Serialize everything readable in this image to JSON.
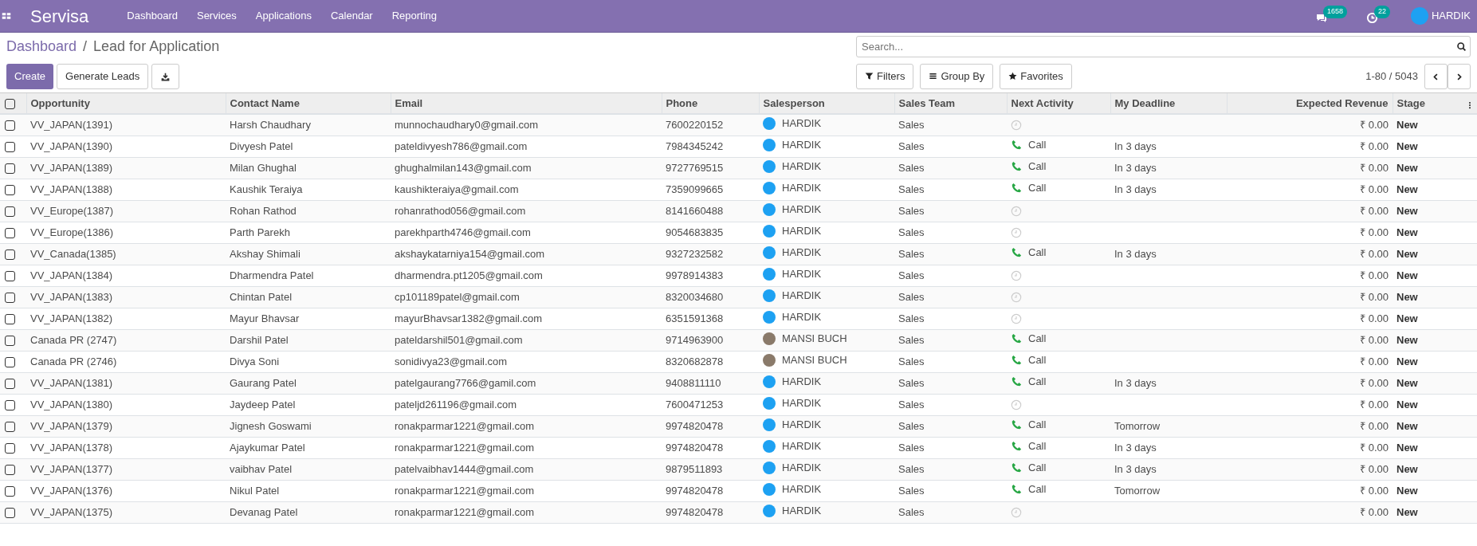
{
  "navbar": {
    "app_title": "Servisa",
    "menu": [
      "Dashboard",
      "Services",
      "Applications",
      "Calendar",
      "Reporting"
    ],
    "messages_count": "1658",
    "activities_count": "22",
    "user": "HARDIK"
  },
  "breadcrumb": {
    "parent": "Dashboard",
    "separator": "/",
    "current": "Lead for Application"
  },
  "buttons": {
    "create": "Create",
    "generate": "Generate Leads"
  },
  "search": {
    "placeholder": "Search..."
  },
  "filters": [
    "Filters",
    "Group By",
    "Favorites"
  ],
  "pager": "1-80 / 5043",
  "table": {
    "select_all_checked": false,
    "columns": [
      "Opportunity",
      "Contact Name",
      "Email",
      "Phone",
      "Salesperson",
      "Sales Team",
      "Next Activity",
      "My Deadline",
      "Expected Revenue",
      "Stage"
    ],
    "rows": [
      {
        "checked": false,
        "opportunity": "VV_JAPAN(1391)",
        "contact": "Harsh Chaudhary",
        "email": "munnochaudhary0@gmail.com",
        "phone": "7600220152",
        "salesperson": {
          "name": "HARDIK",
          "kind": "logo"
        },
        "team": "Sales",
        "activity": {
          "kind": "none"
        },
        "revenue": "₹ 0.00",
        "stage": "New"
      },
      {
        "checked": false,
        "opportunity": "VV_JAPAN(1390)",
        "contact": "Divyesh Patel",
        "email": "pateldivyesh786@gmail.com",
        "phone": "7984345242",
        "salesperson": {
          "name": "HARDIK",
          "kind": "logo"
        },
        "team": "Sales",
        "activity": {
          "kind": "call",
          "label": "Call"
        },
        "deadline": "In 3 days",
        "revenue": "₹ 0.00",
        "stage": "New"
      },
      {
        "checked": false,
        "opportunity": "VV_JAPAN(1389)",
        "contact": "Milan Ghughal",
        "email": "ghughalmilan143@gmail.com",
        "phone": "9727769515",
        "salesperson": {
          "name": "HARDIK",
          "kind": "logo"
        },
        "team": "Sales",
        "activity": {
          "kind": "call",
          "label": "Call"
        },
        "deadline": "In 3 days",
        "revenue": "₹ 0.00",
        "stage": "New"
      },
      {
        "checked": false,
        "opportunity": "VV_JAPAN(1388)",
        "contact": "Kaushik Teraiya",
        "email": "kaushikteraiya@gmail.com",
        "phone": "7359099665",
        "salesperson": {
          "name": "HARDIK",
          "kind": "logo"
        },
        "team": "Sales",
        "activity": {
          "kind": "call",
          "label": "Call"
        },
        "deadline": "In 3 days",
        "revenue": "₹ 0.00",
        "stage": "New"
      },
      {
        "checked": false,
        "opportunity": "VV_Europe(1387)",
        "contact": "Rohan Rathod",
        "email": "rohanrathod056@gmail.com",
        "phone": "8141660488",
        "salesperson": {
          "name": "HARDIK",
          "kind": "logo"
        },
        "team": "Sales",
        "activity": {
          "kind": "none"
        },
        "revenue": "₹ 0.00",
        "stage": "New"
      },
      {
        "checked": false,
        "opportunity": "VV_Europe(1386)",
        "contact": "Parth Parekh",
        "email": "parekhparth4746@gmail.com",
        "phone": "9054683835",
        "salesperson": {
          "name": "HARDIK",
          "kind": "logo"
        },
        "team": "Sales",
        "activity": {
          "kind": "none"
        },
        "revenue": "₹ 0.00",
        "stage": "New"
      },
      {
        "checked": false,
        "opportunity": "VV_Canada(1385)",
        "contact": "Akshay Shimali",
        "email": "akshaykatarniya154@gmail.com",
        "phone": "9327232582",
        "salesperson": {
          "name": "HARDIK",
          "kind": "logo"
        },
        "team": "Sales",
        "activity": {
          "kind": "call",
          "label": "Call"
        },
        "deadline": "In 3 days",
        "revenue": "₹ 0.00",
        "stage": "New"
      },
      {
        "checked": false,
        "opportunity": "VV_JAPAN(1384)",
        "contact": "Dharmendra Patel",
        "email": "dharmendra.pt1205@gmail.com",
        "phone": "9978914383",
        "salesperson": {
          "name": "HARDIK",
          "kind": "logo"
        },
        "team": "Sales",
        "activity": {
          "kind": "none"
        },
        "revenue": "₹ 0.00",
        "stage": "New"
      },
      {
        "checked": false,
        "opportunity": "VV_JAPAN(1383)",
        "contact": "Chintan Patel",
        "email": "cp101189patel@gmail.com",
        "phone": "8320034680",
        "salesperson": {
          "name": "HARDIK",
          "kind": "logo"
        },
        "team": "Sales",
        "activity": {
          "kind": "none"
        },
        "revenue": "₹ 0.00",
        "stage": "New"
      },
      {
        "checked": false,
        "opportunity": "VV_JAPAN(1382)",
        "contact": "Mayur Bhavsar",
        "email": "mayurBhavsar1382@gmail.com",
        "phone": "6351591368",
        "salesperson": {
          "name": "HARDIK",
          "kind": "logo"
        },
        "team": "Sales",
        "activity": {
          "kind": "none"
        },
        "revenue": "₹ 0.00",
        "stage": "New"
      },
      {
        "checked": false,
        "opportunity": "Canada PR (2747)",
        "contact": "Darshil Patel",
        "email": "pateldarshil501@gmail.com",
        "phone": "9714963900",
        "salesperson": {
          "name": "MANSI BUCH",
          "kind": "photo"
        },
        "team": "Sales",
        "activity": {
          "kind": "call",
          "label": "Call"
        },
        "revenue": "₹ 0.00",
        "stage": "New"
      },
      {
        "checked": false,
        "opportunity": "Canada PR (2746)",
        "contact": "Divya Soni",
        "email": "sonidivya23@gmail.com",
        "phone": "8320682878",
        "salesperson": {
          "name": "MANSI BUCH",
          "kind": "photo"
        },
        "team": "Sales",
        "activity": {
          "kind": "call",
          "label": "Call"
        },
        "revenue": "₹ 0.00",
        "stage": "New"
      },
      {
        "checked": false,
        "opportunity": "VV_JAPAN(1381)",
        "contact": "Gaurang Patel",
        "email": "patelgaurang7766@gamil.com",
        "phone": "9408811110",
        "salesperson": {
          "name": "HARDIK",
          "kind": "logo"
        },
        "team": "Sales",
        "activity": {
          "kind": "call",
          "label": "Call"
        },
        "deadline": "In 3 days",
        "revenue": "₹ 0.00",
        "stage": "New"
      },
      {
        "checked": false,
        "opportunity": "VV_JAPAN(1380)",
        "contact": "Jaydeep Patel",
        "email": "pateljd261196@gmail.com",
        "phone": "7600471253",
        "salesperson": {
          "name": "HARDIK",
          "kind": "logo"
        },
        "team": "Sales",
        "activity": {
          "kind": "none"
        },
        "revenue": "₹ 0.00",
        "stage": "New"
      },
      {
        "checked": false,
        "opportunity": "VV_JAPAN(1379)",
        "contact": "Jignesh Goswami",
        "email": "ronakparmar1221@gmail.com",
        "phone": "9974820478",
        "salesperson": {
          "name": "HARDIK",
          "kind": "logo"
        },
        "team": "Sales",
        "activity": {
          "kind": "call",
          "label": "Call"
        },
        "deadline": "Tomorrow",
        "revenue": "₹ 0.00",
        "stage": "New"
      },
      {
        "checked": false,
        "opportunity": "VV_JAPAN(1378)",
        "contact": "Ajaykumar Patel",
        "email": "ronakparmar1221@gmail.com",
        "phone": "9974820478",
        "salesperson": {
          "name": "HARDIK",
          "kind": "logo"
        },
        "team": "Sales",
        "activity": {
          "kind": "call",
          "label": "Call"
        },
        "deadline": "In 3 days",
        "revenue": "₹ 0.00",
        "stage": "New"
      },
      {
        "checked": false,
        "opportunity": "VV_JAPAN(1377)",
        "contact": "vaibhav Patel",
        "email": "patelvaibhav1444@gmail.com",
        "phone": "9879511893",
        "salesperson": {
          "name": "HARDIK",
          "kind": "logo"
        },
        "team": "Sales",
        "activity": {
          "kind": "call",
          "label": "Call"
        },
        "deadline": "In 3 days",
        "revenue": "₹ 0.00",
        "stage": "New"
      },
      {
        "checked": false,
        "opportunity": "VV_JAPAN(1376)",
        "contact": "Nikul Patel",
        "email": "ronakparmar1221@gmail.com",
        "phone": "9974820478",
        "salesperson": {
          "name": "HARDIK",
          "kind": "logo"
        },
        "team": "Sales",
        "activity": {
          "kind": "call",
          "label": "Call"
        },
        "deadline": "Tomorrow",
        "revenue": "₹ 0.00",
        "stage": "New"
      },
      {
        "checked": false,
        "opportunity": "VV_JAPAN(1375)",
        "contact": "Devanag Patel",
        "email": "ronakparmar1221@gmail.com",
        "phone": "9974820478",
        "salesperson": {
          "name": "HARDIK",
          "kind": "logo"
        },
        "team": "Sales",
        "activity": {
          "kind": "none"
        },
        "revenue": "₹ 0.00",
        "stage": "New"
      }
    ]
  }
}
